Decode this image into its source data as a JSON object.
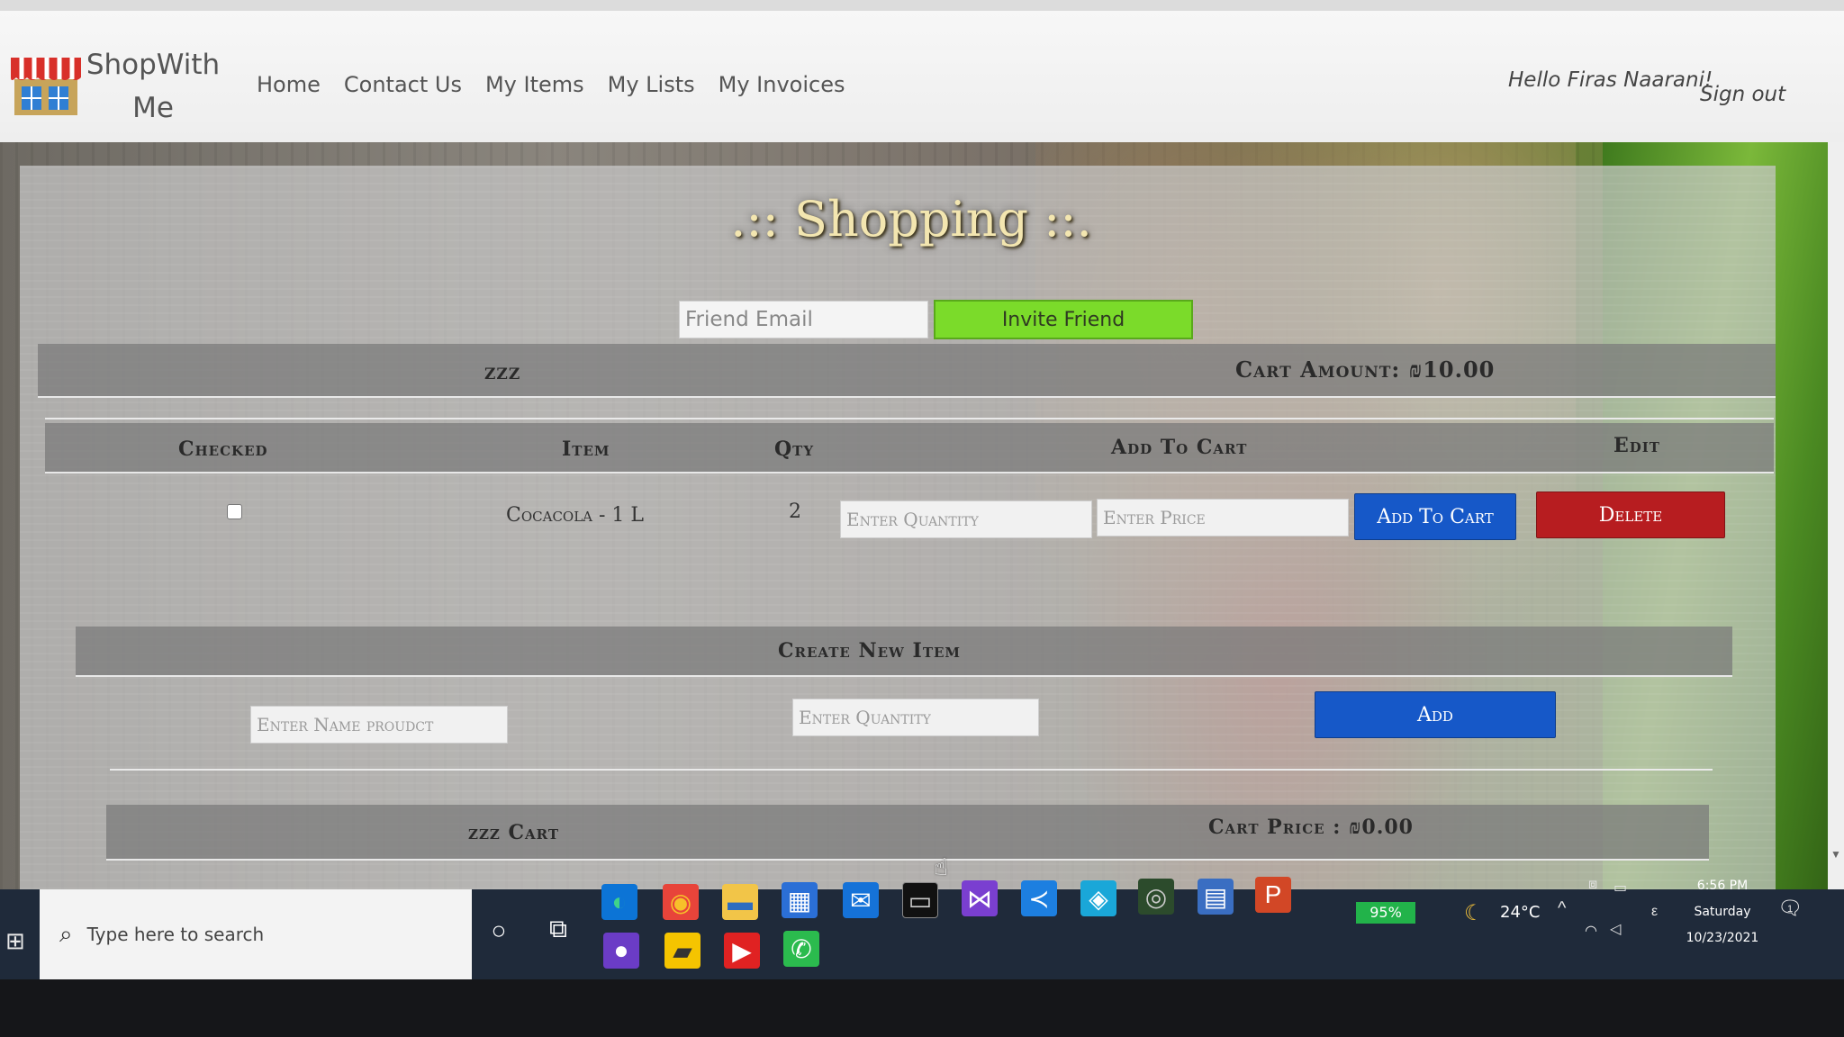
{
  "nav": {
    "brand": "ShopWith Me",
    "links": [
      "Home",
      "Contact Us",
      "My Items",
      "My Lists",
      "My Invoices"
    ],
    "greeting": "Hello Firas Naarani!",
    "signout": "Sign out"
  },
  "page": {
    "title": ".:: Shopping ::.",
    "invite_placeholder": "Friend Email",
    "invite_button": "Invite Friend",
    "list_name": "zzz",
    "cart_amount": "Cart Amount: ₪10.00"
  },
  "table": {
    "headers": [
      "Checked",
      "Item",
      "Qty",
      "Add To Cart",
      "Edit"
    ],
    "rows": [
      {
        "checked": false,
        "item": "Cocacola - 1 L",
        "qty": "2",
        "qty_placeholder": "Enter Quantity",
        "price_placeholder": "Enter Price",
        "add_button": "Add To Cart",
        "delete_button": "Delete"
      }
    ]
  },
  "create": {
    "header": "Create New Item",
    "name_placeholder": "Enter Name proudct",
    "qty_placeholder": "Enter Quantity",
    "add_button": "Add"
  },
  "cart": {
    "title": "zzz Cart",
    "price": "Cart Price : ₪0.00"
  },
  "taskbar": {
    "search_placeholder": "Type here to search",
    "battery": "95%",
    "temperature": "24°C",
    "time": "6:56 PM",
    "day": "Saturday",
    "date": "10/23/2021",
    "notifications": "1"
  },
  "colors": {
    "invite_green": "#7bdb2a",
    "add_blue": "#1658c8",
    "delete_red": "#b71d20",
    "title_cream": "#f3e6b0"
  },
  "icons": {
    "logo": "shop-awning-icon",
    "start": "windows-icon",
    "search": "search-icon",
    "cortana": "cortana-icon",
    "taskview": "task-view-icon",
    "edge": "edge-icon",
    "chrome": "chrome-icon",
    "explorer": "folder-icon",
    "store": "store-icon",
    "mail": "mail-icon",
    "terminal": "terminal-icon",
    "vs": "visual-studio-icon",
    "vscode": "vscode-icon",
    "azure": "azure-icon",
    "camera": "camera-icon",
    "calculator": "calculator-icon",
    "powerpoint": "powerpoint-icon",
    "github": "github-icon",
    "notes": "sticky-notes-icon",
    "youtube": "youtube-icon",
    "whatsapp": "whatsapp-icon"
  }
}
